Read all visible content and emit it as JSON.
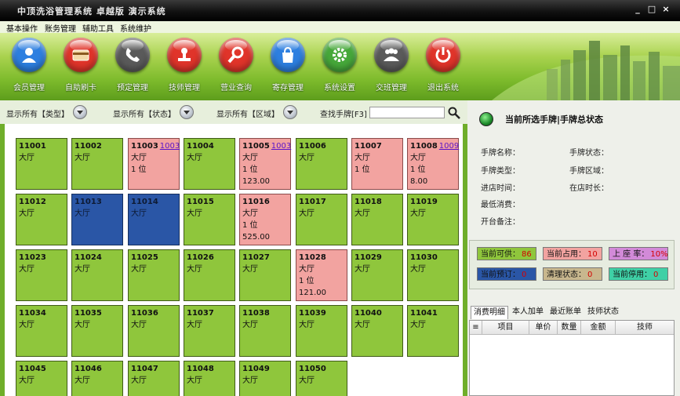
{
  "window": {
    "title": "中顶洗浴管理系统 卓越版 演示系统",
    "minimize": "_",
    "maximize": "□",
    "close": "×"
  },
  "menu": [
    "基本操作",
    "账务管理",
    "辅助工具",
    "系统维护"
  ],
  "toolbar": [
    {
      "label": "会员管理",
      "icon": "user-icon",
      "color": "#2d7fe0"
    },
    {
      "label": "自助刷卡",
      "icon": "card-icon",
      "color": "#e0342a"
    },
    {
      "label": "预定管理",
      "icon": "phone-icon",
      "color": "#5a5a5a"
    },
    {
      "label": "技师管理",
      "icon": "stamp-icon",
      "color": "#e0342a"
    },
    {
      "label": "营业查询",
      "icon": "search-icon",
      "color": "#e0342a"
    },
    {
      "label": "寄存管理",
      "icon": "bag-icon",
      "color": "#2d7fe0"
    },
    {
      "label": "系统设置",
      "icon": "gear-icon",
      "color": "#46a83a"
    },
    {
      "label": "交班管理",
      "icon": "people-icon",
      "color": "#5a5a5a"
    },
    {
      "label": "退出系统",
      "icon": "power-icon",
      "color": "#e0342a"
    }
  ],
  "filters": {
    "type": "显示所有【类型】",
    "status": "显示所有【状态】",
    "area": "显示所有【区域】",
    "search_label": "查找手牌[F3]",
    "search_value": ""
  },
  "cards": [
    {
      "num": "11001",
      "area": "大厅",
      "status": "free"
    },
    {
      "num": "11002",
      "area": "大厅",
      "status": "free"
    },
    {
      "num": "11003",
      "link": "1003",
      "area": "大厅",
      "persons": "1 位",
      "status": "busy"
    },
    {
      "num": "11004",
      "area": "大厅",
      "status": "free"
    },
    {
      "num": "11005",
      "link": "1003",
      "area": "大厅",
      "persons": "1 位",
      "amount": "123.00",
      "status": "busy"
    },
    {
      "num": "11006",
      "area": "大厅",
      "status": "free"
    },
    {
      "num": "11007",
      "area": "大厅",
      "persons": "1 位",
      "status": "busy"
    },
    {
      "num": "11008",
      "link": "1009",
      "area": "大厅",
      "persons": "1 位",
      "amount": "8.00",
      "status": "busy"
    },
    {
      "num": "11012",
      "area": "大厅",
      "status": "free"
    },
    {
      "num": "11013",
      "area": "大厅",
      "status": "reserved"
    },
    {
      "num": "11014",
      "area": "大厅",
      "status": "reserved"
    },
    {
      "num": "11015",
      "area": "大厅",
      "status": "free"
    },
    {
      "num": "11016",
      "area": "大厅",
      "persons": "1 位",
      "amount": "525.00",
      "status": "busy"
    },
    {
      "num": "11017",
      "area": "大厅",
      "status": "free"
    },
    {
      "num": "11018",
      "area": "大厅",
      "status": "free"
    },
    {
      "num": "11019",
      "area": "大厅",
      "status": "free"
    },
    {
      "num": "11023",
      "area": "大厅",
      "status": "free"
    },
    {
      "num": "11024",
      "area": "大厅",
      "status": "free"
    },
    {
      "num": "11025",
      "area": "大厅",
      "status": "free"
    },
    {
      "num": "11026",
      "area": "大厅",
      "status": "free"
    },
    {
      "num": "11027",
      "area": "大厅",
      "status": "free"
    },
    {
      "num": "11028",
      "area": "大厅",
      "persons": "1 位",
      "amount": "121.00",
      "status": "busy"
    },
    {
      "num": "11029",
      "area": "大厅",
      "status": "free"
    },
    {
      "num": "11030",
      "area": "大厅",
      "status": "free"
    },
    {
      "num": "11034",
      "area": "大厅",
      "status": "free"
    },
    {
      "num": "11035",
      "area": "大厅",
      "status": "free"
    },
    {
      "num": "11036",
      "area": "大厅",
      "status": "free"
    },
    {
      "num": "11037",
      "area": "大厅",
      "status": "free"
    },
    {
      "num": "11038",
      "area": "大厅",
      "status": "free"
    },
    {
      "num": "11039",
      "area": "大厅",
      "status": "free"
    },
    {
      "num": "11040",
      "area": "大厅",
      "status": "free"
    },
    {
      "num": "11041",
      "area": "大厅",
      "status": "free"
    },
    {
      "num": "11045",
      "area": "大厅",
      "status": "free"
    },
    {
      "num": "11046",
      "area": "大厅",
      "status": "free"
    },
    {
      "num": "11047",
      "area": "大厅",
      "status": "free"
    },
    {
      "num": "11048",
      "area": "大厅",
      "status": "free"
    },
    {
      "num": "11049",
      "area": "大厅",
      "status": "free"
    },
    {
      "num": "11050",
      "area": "大厅",
      "status": "free"
    }
  ],
  "status_panel": {
    "title": "当前所选手牌|手牌总状态",
    "fields_left": [
      "手牌名称：",
      "手牌类型：",
      "进店时间：",
      "最低消费：",
      "开台备注："
    ],
    "fields_right": [
      "手牌状态：",
      "手牌区域：",
      "在店时长："
    ]
  },
  "stats": [
    {
      "label": "当前可供：",
      "value": "86",
      "color": "#8fc63c"
    },
    {
      "label": "当前占用：",
      "value": "10",
      "color": "#f2a3a0"
    },
    {
      "label": "上 座 率：",
      "value": "10%",
      "color": "#d28ad8"
    },
    {
      "label": "当前预订：",
      "value": "0",
      "color": "#2a56a6"
    },
    {
      "label": "清理状态：",
      "value": "0",
      "color": "#c8b78e"
    },
    {
      "label": "当前停用：",
      "value": "0",
      "color": "#3fd0a6"
    }
  ],
  "tabs": [
    "消费明细",
    "本人加单",
    "最近账单",
    "技师状态"
  ],
  "table_headers": [
    "项目",
    "单价",
    "数量",
    "金额",
    "技师"
  ]
}
